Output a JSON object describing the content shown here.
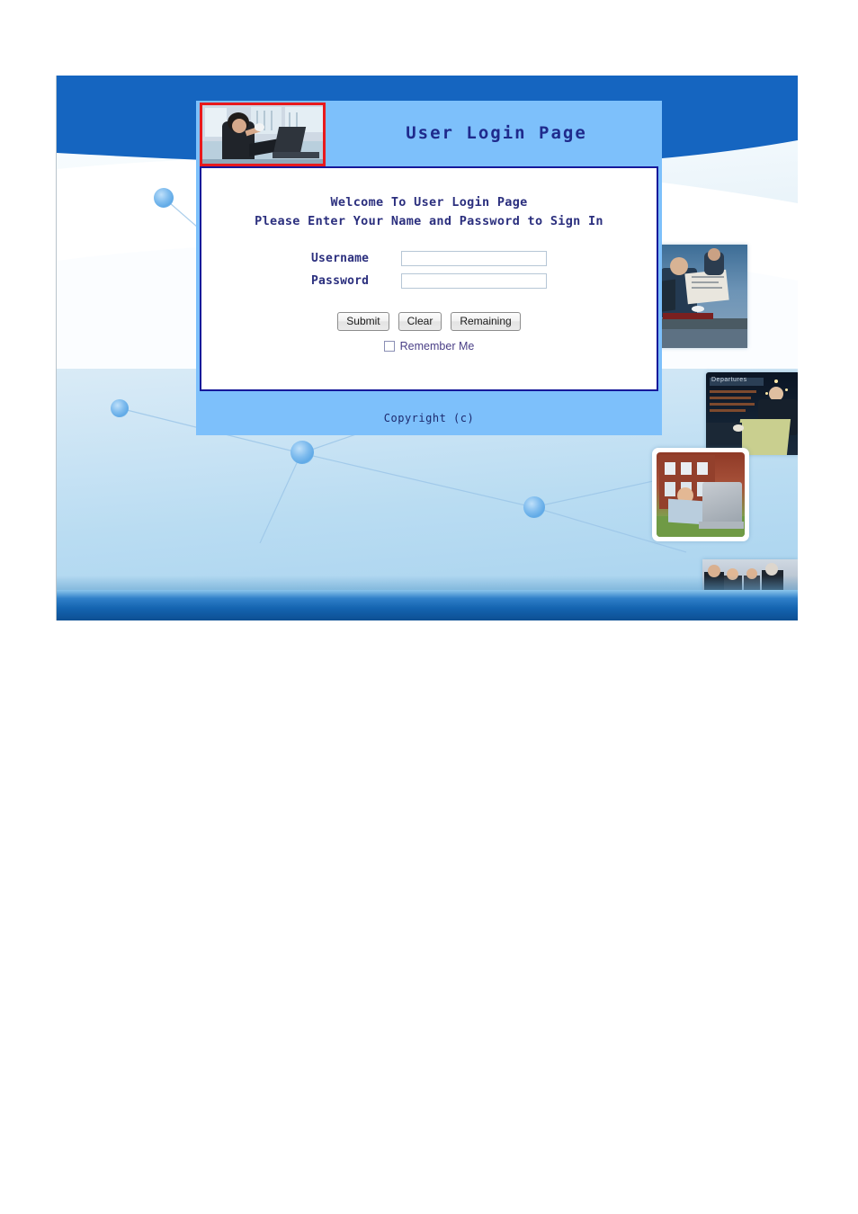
{
  "page": {
    "title": "User Login Page",
    "background_colors": {
      "top_band": "#1565C0",
      "panel": "#7DC0FB",
      "form_border": "#16199A",
      "thumb_border": "#E8191C",
      "text_navy": "#2B2F7E",
      "footer_bar": "#1464B0"
    }
  },
  "login": {
    "header": {
      "title": "User Login Page",
      "thumbnail_alt": "man-at-laptop-photo"
    },
    "welcome": {
      "line1": "Welcome To User Login Page",
      "line2": "Please Enter Your Name and Password to Sign In"
    },
    "fields": [
      {
        "label": "Username",
        "value": "",
        "placeholder": "",
        "type": "text"
      },
      {
        "label": "Password",
        "value": "",
        "placeholder": "",
        "type": "password"
      }
    ],
    "buttons": [
      {
        "label": "Submit"
      },
      {
        "label": "Clear"
      },
      {
        "label": "Remaining"
      }
    ],
    "remember": {
      "label": "Remember Me",
      "checked": false
    },
    "footer": {
      "copyright": "Copyright (c)"
    }
  },
  "decor": {
    "photos": [
      {
        "name": "businessman-reading-newspaper"
      },
      {
        "name": "airport-departures-operator"
      },
      {
        "name": "student-with-laptop-campus"
      },
      {
        "name": "team-around-laptop"
      }
    ],
    "nodes": 5
  }
}
